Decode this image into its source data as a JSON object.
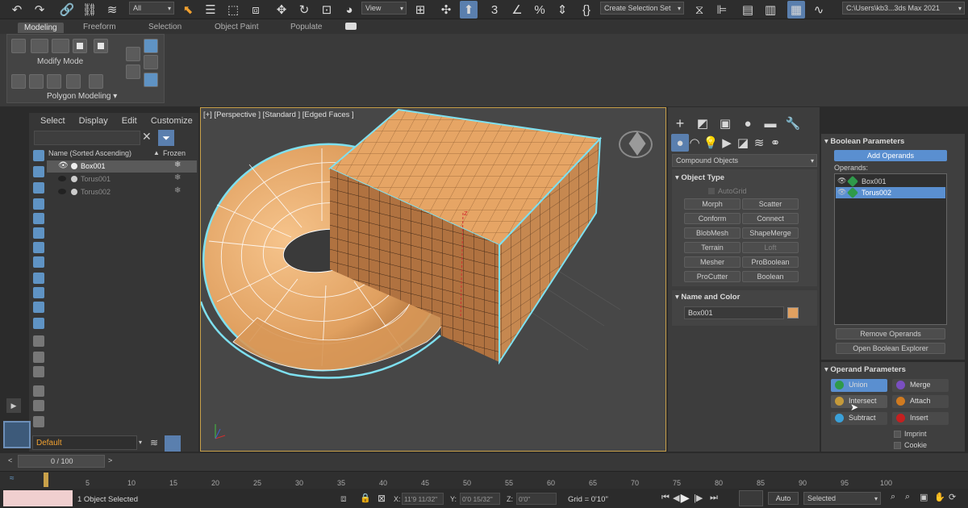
{
  "toolbar": {
    "selection_filter": "All",
    "reference_coord": "View",
    "create_selection_set": "Create Selection Set",
    "project_path": "C:\\Users\\kb3...3ds Max 2021"
  },
  "ribbon": {
    "tabs": [
      "Modeling",
      "Freeform",
      "Selection",
      "Object Paint",
      "Populate"
    ],
    "active_tab": "Modeling",
    "modify_mode": "Modify Mode",
    "polygon_modeling": "Polygon Modeling"
  },
  "scene_explorer": {
    "menu": [
      "Select",
      "Display",
      "Edit",
      "Customize"
    ],
    "col_name": "Name (Sorted Ascending)",
    "col_frozen": "Frozen",
    "rows": [
      {
        "name": "Box001",
        "selected": true
      },
      {
        "name": "Torus001",
        "selected": false
      },
      {
        "name": "Torus002",
        "selected": false
      }
    ],
    "layer": "Default"
  },
  "viewport": {
    "label": "[+] [Perspective ] [Standard ] [Edged Faces ]",
    "colors": {
      "object": "#e0a060",
      "border": "#c9a14a",
      "selection": "#7ee0f0"
    }
  },
  "command_panel": {
    "category": "Compound Objects",
    "object_type_title": "Object Type",
    "autogrid": "AutoGrid",
    "object_buttons": [
      {
        "label": "Morph",
        "enabled": true
      },
      {
        "label": "Scatter",
        "enabled": true
      },
      {
        "label": "Conform",
        "enabled": true
      },
      {
        "label": "Connect",
        "enabled": true
      },
      {
        "label": "BlobMesh",
        "enabled": true
      },
      {
        "label": "ShapeMerge",
        "enabled": true
      },
      {
        "label": "Terrain",
        "enabled": true
      },
      {
        "label": "Loft",
        "enabled": false
      },
      {
        "label": "Mesher",
        "enabled": true
      },
      {
        "label": "ProBoolean",
        "enabled": true
      },
      {
        "label": "ProCutter",
        "enabled": true
      },
      {
        "label": "Boolean",
        "enabled": true
      }
    ],
    "name_color_title": "Name and Color",
    "object_name": "Box001",
    "object_color": "#e0a060"
  },
  "boolean_params": {
    "title": "Boolean Parameters",
    "add_operands": "Add Operands",
    "operands_label": "Operands:",
    "operands": [
      {
        "name": "Box001",
        "selected": false
      },
      {
        "name": "Torus002",
        "selected": true
      }
    ],
    "remove_operands": "Remove Operands",
    "open_explorer": "Open Boolean Explorer"
  },
  "operand_params": {
    "title": "Operand Parameters",
    "buttons": [
      {
        "label": "Union",
        "color": "#2f9a4a",
        "active": true
      },
      {
        "label": "Merge",
        "color": "#7a4fc0",
        "active": false
      },
      {
        "label": "Intersect",
        "color": "#c59a3a",
        "active": false
      },
      {
        "label": "Attach",
        "color": "#d07a20",
        "active": false
      },
      {
        "label": "Subtract",
        "color": "#3aa0d8",
        "active": false
      },
      {
        "label": "Insert",
        "color": "#c42020",
        "active": false
      }
    ],
    "imprint": "Imprint",
    "cookie": "Cookie"
  },
  "timeline": {
    "frame_readout": "0 / 100",
    "ticks": [
      "5",
      "10",
      "15",
      "20",
      "25",
      "30",
      "35",
      "40",
      "45",
      "50",
      "55",
      "60",
      "65",
      "70",
      "75",
      "80",
      "85",
      "90",
      "95",
      "100"
    ]
  },
  "status": {
    "selection": "1 Object Selected",
    "x_label": "X:",
    "x_value": "11'9 11/32\"",
    "y_label": "Y:",
    "y_value": "0'0 15/32\"",
    "z_label": "Z:",
    "z_value": "0'0\"",
    "grid": "Grid = 0'10\"",
    "auto": "Auto",
    "selected": "Selected"
  }
}
